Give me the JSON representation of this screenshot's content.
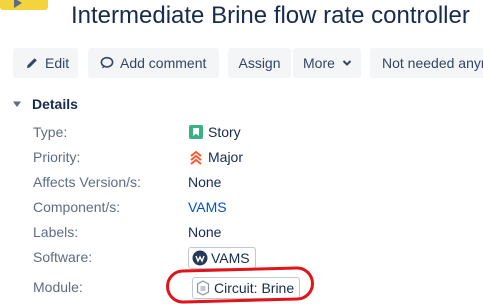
{
  "issue": {
    "title": "Intermediate Brine flow rate controller"
  },
  "toolbar": {
    "edit_label": "Edit",
    "comment_label": "Add comment",
    "assign_label": "Assign",
    "more_label": "More",
    "not_needed_label": "Not needed anym"
  },
  "details": {
    "heading": "Details",
    "rows": [
      {
        "label": "Type:",
        "value": "Story",
        "icon": "story-icon"
      },
      {
        "label": "Priority:",
        "value": "Major",
        "icon": "major-priority-icon"
      },
      {
        "label": "Affects Version/s:",
        "value": "None"
      },
      {
        "label": "Component/s:",
        "value": "VAMS"
      },
      {
        "label": "Labels:",
        "value": "None"
      },
      {
        "label": "Software:",
        "value": "VAMS",
        "icon": "vams-badge-icon"
      },
      {
        "label": "Module:",
        "value": "Circuit: Brine",
        "icon": "module-icon"
      }
    ]
  },
  "colors": {
    "accent": "#0052cc",
    "story_green": "#36b37e",
    "priority_orange": "#ff5630",
    "highlight_red": "#e0141a"
  }
}
